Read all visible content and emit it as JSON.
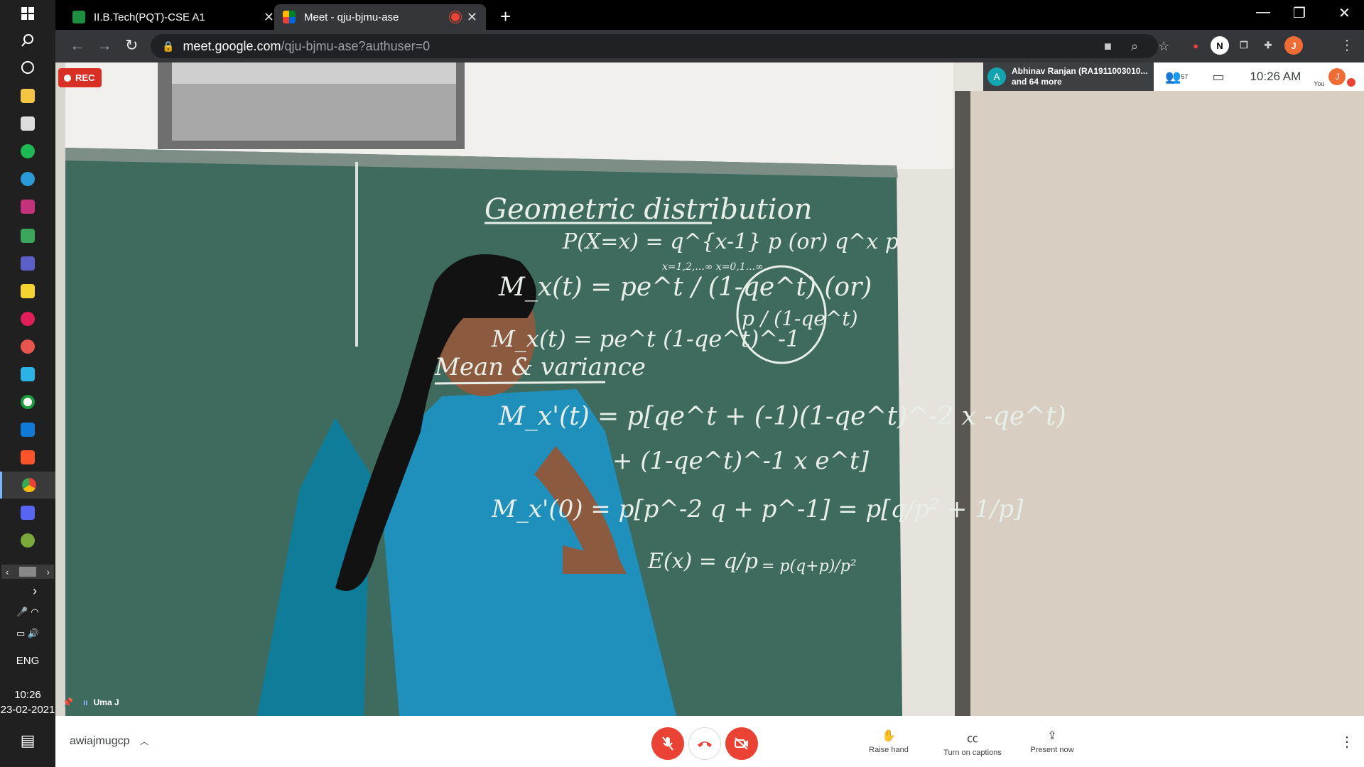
{
  "taskbar": {
    "icons": [
      "windows-start-icon",
      "search-icon",
      "task-view-icon",
      "file-explorer-icon",
      "store-icon",
      "spotify-icon",
      "edge-icon",
      "intellij-icon",
      "drive-icon",
      "teams-icon",
      "sticky-notes-icon",
      "slack-icon",
      "paint-icon",
      "files-icon",
      "app-icon",
      "mail-icon",
      "brave-icon",
      "chrome-icon",
      "discord-icon",
      "misc-icon"
    ],
    "language": "ENG",
    "time": "10:26",
    "date": "23-02-2021"
  },
  "browser": {
    "tabs": [
      {
        "title": "II.B.Tech(PQT)-CSE A1"
      },
      {
        "title": "Meet - qju-bjmu-ase"
      }
    ],
    "url_host": "meet.google.com",
    "url_path": "/qju-bjmu-ase?authuser=0",
    "profile_initial": "J"
  },
  "meet": {
    "rec_label": "REC",
    "participants_chip": {
      "avatar": "A",
      "line1": "Abhinav Ranjan (RA1911003010...",
      "line2": "and 64 more"
    },
    "participant_count": "57",
    "time": "10:26 AM",
    "you_label": "You",
    "you_initial": "J",
    "speaker_name": "Uma J",
    "meeting_code": "awiajmugcp",
    "controls": {
      "raise_hand": "Raise hand",
      "captions": "Turn on captions",
      "present": "Present now"
    }
  },
  "board": {
    "lines": [
      "Geometric distribution",
      "P(X=x) = q^{x-1} p  (or)  q^x p",
      "x=1,2,...∞        x=0,1...∞",
      "M_x(t) = pe^t / (1-qe^t)   (or)",
      "p / (1-qe^t)",
      "M_x(t) = pe^t (1-qe^t)^-1",
      "Mean & variance",
      "M_x'(t) = p[qe^t + (-1)(1-qe^t)^-2 x -qe^t)",
      "+ (1-qe^t)^-1 x e^t]",
      "M_x'(0) = p[p^-2 q + p^-1] = p[q/p² + 1/p]",
      "E(x) = q/p",
      "= p(q+p)/p²"
    ]
  }
}
